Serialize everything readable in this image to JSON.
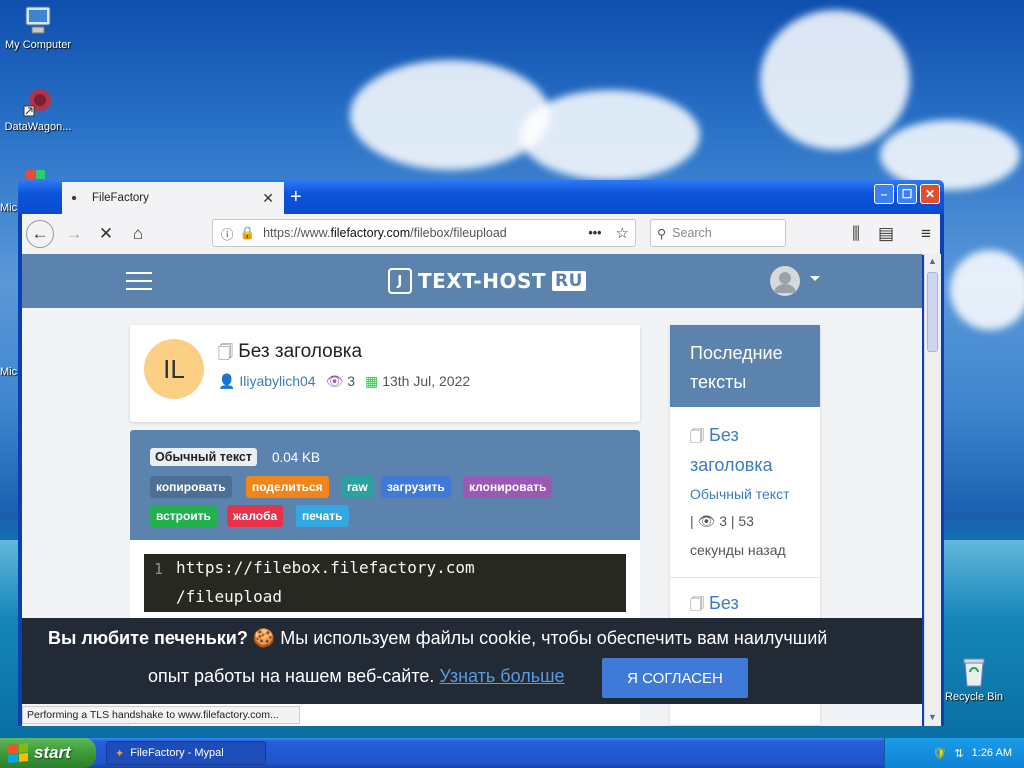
{
  "desktop": {
    "icons": [
      {
        "label": "My Computer"
      },
      {
        "label": "DataWagon..."
      },
      {
        "label": "Mic"
      },
      {
        "label": "Mic"
      },
      {
        "label": "Recycle Bin"
      }
    ]
  },
  "browser": {
    "tab_title": "FileFactory",
    "url_prefix": "https://www.",
    "url_domain": "filefactory.com",
    "url_path": "/filebox/fileupload",
    "search_placeholder": "Search",
    "status": "Performing a TLS handshake to www.filefactory.com..."
  },
  "site": {
    "logo_text": "TEXT-HOST",
    "logo_suffix": "RU",
    "logo_mark": "J",
    "paste": {
      "avatar_initials": "IL",
      "title": "Без заголовка",
      "author": "Iliyabylich04",
      "views": "3",
      "date": "13th Jul, 2022",
      "type": "Обычный текст",
      "size": "0.04 KB",
      "buttons": {
        "copy": "копировать",
        "share": "поделиться",
        "raw": "raw",
        "download": "загрузить",
        "clone": "клонировать",
        "embed": "встроить",
        "report": "жалоба",
        "print": "печать"
      },
      "code_line_number": "1",
      "code_line1": "https://filebox.filefactory.com",
      "code_line2": "/fileupload"
    },
    "sidebar": {
      "heading_line1": "Последние",
      "heading_line2": "тексты",
      "item1_title_line1": "Без",
      "item1_title_line2": "заголовка",
      "item1_type": "Обычный текст",
      "item1_meta_views": "| 👁 3 | 53",
      "item1_meta_time": "секунды назад",
      "item2_title": "Без"
    },
    "cookie": {
      "bold": "Вы любите печеньки?",
      "line1_rest": "🍪 Мы используем файлы cookie, чтобы обеспечить вам наилучший",
      "line2": "опыт работы на нашем веб-сайте.",
      "learn_more": "Узнать больше",
      "agree": "Я СОГЛАСЕН"
    }
  },
  "taskbar": {
    "start": "start",
    "task": "FileFactory - Mypal",
    "clock": "1:26 AM"
  },
  "colors": {
    "header": "#5b83ae",
    "copy": "#4e6f94",
    "share": "#f0861a",
    "raw": "#2aa3a0",
    "download": "#3f7ad9",
    "clone": "#9b59b6",
    "embed": "#23b14d",
    "report": "#e8324a",
    "print": "#35a7e0"
  }
}
